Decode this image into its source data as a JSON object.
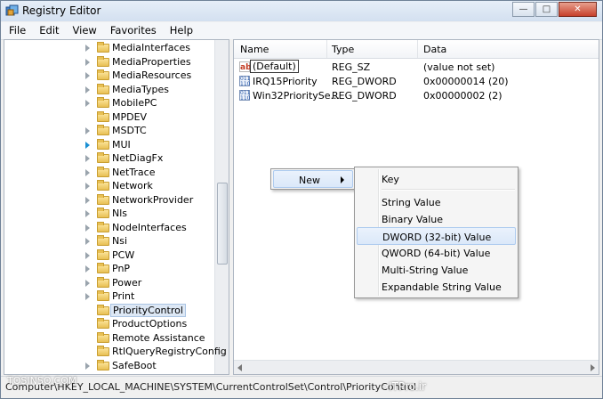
{
  "window": {
    "title": "Registry Editor",
    "minimize": "—",
    "maximize": "□",
    "close": "✕"
  },
  "menubar": [
    "File",
    "Edit",
    "View",
    "Favorites",
    "Help"
  ],
  "tree": {
    "items": [
      {
        "label": "MediaInterfaces",
        "arrow": true
      },
      {
        "label": "MediaProperties",
        "arrow": true
      },
      {
        "label": "MediaResources",
        "arrow": true
      },
      {
        "label": "MediaTypes",
        "arrow": true
      },
      {
        "label": "MobilePC",
        "arrow": true
      },
      {
        "label": "MPDEV",
        "arrow": false
      },
      {
        "label": "MSDTC",
        "arrow": true
      },
      {
        "label": "MUI",
        "arrow": true
      },
      {
        "label": "NetDiagFx",
        "arrow": true
      },
      {
        "label": "NetTrace",
        "arrow": true
      },
      {
        "label": "Network",
        "arrow": true
      },
      {
        "label": "NetworkProvider",
        "arrow": true
      },
      {
        "label": "Nls",
        "arrow": true
      },
      {
        "label": "NodeInterfaces",
        "arrow": true
      },
      {
        "label": "Nsi",
        "arrow": true
      },
      {
        "label": "PCW",
        "arrow": true
      },
      {
        "label": "PnP",
        "arrow": true
      },
      {
        "label": "Power",
        "arrow": true
      },
      {
        "label": "Print",
        "arrow": true
      },
      {
        "label": "PriorityControl",
        "arrow": false,
        "selected": true
      },
      {
        "label": "ProductOptions",
        "arrow": false
      },
      {
        "label": "Remote Assistance",
        "arrow": false
      },
      {
        "label": "RtlQueryRegistryConfig",
        "arrow": false
      },
      {
        "label": "SafeBoot",
        "arrow": true
      }
    ]
  },
  "list": {
    "headers": {
      "name": "Name",
      "type": "Type",
      "data": "Data"
    },
    "rows": [
      {
        "icon": "string-value-icon",
        "icon_text": "ab",
        "name": "(Default)",
        "type": "REG_SZ",
        "data": "(value not set)",
        "editing": true
      },
      {
        "icon": "dword-value-icon",
        "icon_text": "011\n110",
        "name": "IRQ15Priority",
        "type": "REG_DWORD",
        "data": "0x00000014 (20)"
      },
      {
        "icon": "dword-value-icon",
        "icon_text": "011\n110",
        "name": "Win32PrioritySe...",
        "type": "REG_DWORD",
        "data": "0x00000002 (2)"
      }
    ]
  },
  "context_menu": {
    "label": "New"
  },
  "submenu": {
    "items": [
      "Key",
      "String Value",
      "Binary Value",
      "DWORD (32-bit) Value",
      "QWORD (64-bit) Value",
      "Multi-String Value",
      "Expandable String Value"
    ],
    "highlighted": "DWORD (32-bit) Value"
  },
  "statusbar": {
    "path": "Computer\\HKEY_LOCAL_MACHINE\\SYSTEM\\CurrentControlSet\\Control\\PriorityControl",
    "watermark_left": "TOSINSO.COM",
    "watermark_right": "- ITPro.ir"
  }
}
